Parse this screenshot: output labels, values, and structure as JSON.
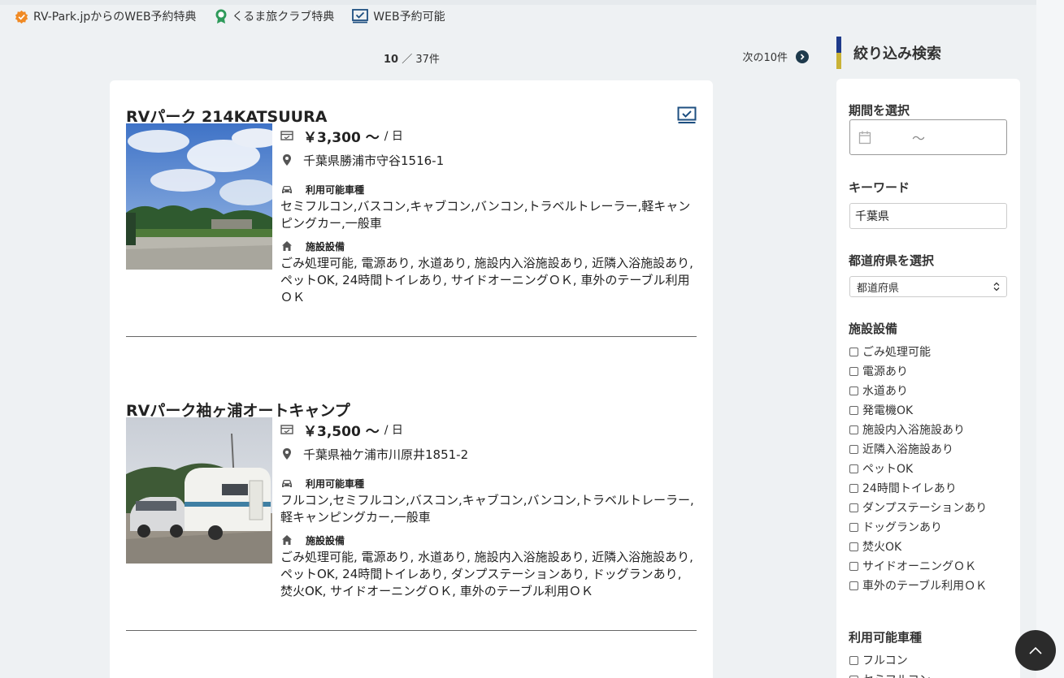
{
  "legend": [
    {
      "label": "RV-Park.jpからのWEB予約特典",
      "icon": "orange-badge-check-icon"
    },
    {
      "label": "くるま旅クラブ特典",
      "icon": "green-award-icon"
    },
    {
      "label": "WEB予約可能",
      "icon": "web-reservation-icon"
    }
  ],
  "pager": {
    "current": "10",
    "separator": "／",
    "total": "37件",
    "next_label": "次の10件"
  },
  "listings": [
    {
      "title": "RVパーク 214KATSUURA",
      "price": "￥3,300 〜",
      "price_unit": "/ 日",
      "address": "千葉県勝浦市守谷1516-1",
      "vehicles_heading": "利用可能車種",
      "vehicles": "セミフルコン,バスコン,キャブコン,バンコン,トラベルトレーラー,軽キャンピングカー,一般車",
      "facilities_heading": "施設設備",
      "facilities": "ごみ処理可能, 電源あり, 水道あり, 施設内入浴施設あり, 近隣入浴施設あり, ペットOK, 24時間トイレあり, サイドオーニングＯＫ, 車外のテーブル利用ＯＫ"
    },
    {
      "title": "RVパーク袖ヶ浦オートキャンプ",
      "price": "￥3,500 〜",
      "price_unit": "/ 日",
      "address": "千葉県袖ケ浦市川原井1851-2",
      "vehicles_heading": "利用可能車種",
      "vehicles": "フルコン,セミフルコン,バスコン,キャブコン,バンコン,トラベルトレーラー,軽キャンピングカー,一般車",
      "facilities_heading": "施設設備",
      "facilities": "ごみ処理可能, 電源あり, 水道あり, 施設内入浴施設あり, 近隣入浴施設あり, ペットOK, 24時間トイレあり, ダンプステーションあり, ドッグランあり, 焚火OK, サイドオーニングＯＫ, 車外のテーブル利用ＯＫ"
    }
  ],
  "sidebar": {
    "title": "絞り込み検索",
    "period_label": "期間を選択",
    "period_separator": "〜",
    "keyword_label": "キーワード",
    "keyword_value": "千葉県",
    "prefecture_label": "都道府県を選択",
    "prefecture_value": "都道府県",
    "facilities_label": "施設設備",
    "facilities": [
      "ごみ処理可能",
      "電源あり",
      "水道あり",
      "発電機OK",
      "施設内入浴施設あり",
      "近隣入浴施設あり",
      "ペットOK",
      "24時間トイレあり",
      "ダンプステーションあり",
      "ドッグランあり",
      "焚火OK",
      "サイドオーニングＯＫ",
      "車外のテーブル利用ＯＫ"
    ],
    "vehicles_label": "利用可能車種",
    "vehicles": [
      "フルコン",
      "セミフルコン"
    ]
  },
  "colors": {
    "accent_navy": "#1e3a4c",
    "accent_gold": "#c9b236",
    "badge_orange": "#f08a24",
    "badge_green": "#2e9a5a",
    "web_blue": "#1e4f80"
  }
}
